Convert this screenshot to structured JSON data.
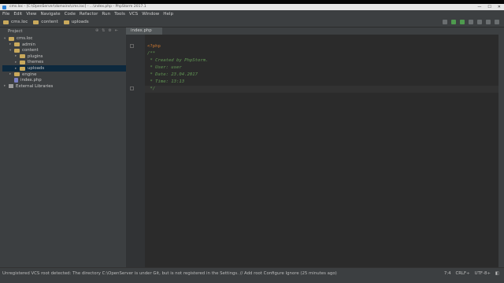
{
  "window": {
    "title": "cms.loc - [C:\\OpenServer\\domains\\cms.loc] - ...\\index.php - PhpStorm 2017.1",
    "controls": [
      "—",
      "☐",
      "✕"
    ]
  },
  "menu": [
    "File",
    "Edit",
    "View",
    "Navigate",
    "Code",
    "Refactor",
    "Run",
    "Tools",
    "VCS",
    "Window",
    "Help"
  ],
  "breadcrumbs": [
    "cms.loc",
    "content",
    "uploads"
  ],
  "project_panel": {
    "view_selector": "Project",
    "tree": [
      {
        "label": "cms.loc",
        "type": "folder",
        "level": 0,
        "expanded": true
      },
      {
        "label": "admin",
        "type": "folder",
        "level": 1,
        "expanded": false
      },
      {
        "label": "content",
        "type": "folder",
        "level": 1,
        "expanded": true
      },
      {
        "label": "plugins",
        "type": "folder",
        "level": 2,
        "expanded": false
      },
      {
        "label": "themes",
        "type": "folder",
        "level": 2,
        "expanded": false
      },
      {
        "label": "uploads",
        "type": "folder",
        "level": 2,
        "expanded": false,
        "selected": true
      },
      {
        "label": "engine",
        "type": "folder",
        "level": 1,
        "expanded": false
      },
      {
        "label": "index.php",
        "type": "php",
        "level": 1
      },
      {
        "label": "External Libraries",
        "type": "lib",
        "level": 0,
        "expanded": false
      }
    ]
  },
  "editor": {
    "tab_label": "index.php",
    "lines": [
      {
        "text": "<?php",
        "kind": "php"
      },
      {
        "text": "/**",
        "kind": "doc"
      },
      {
        "text": " * Created by PhpStorm.",
        "kind": "doc"
      },
      {
        "text": " * User: user",
        "kind": "doc"
      },
      {
        "text": " * Date: 23.04.2017",
        "kind": "doc"
      },
      {
        "text": " * Time: 13:13",
        "kind": "doc"
      },
      {
        "text": " */",
        "kind": "doc"
      }
    ]
  },
  "status": {
    "message": "Unregistered VCS root detected: The directory C:\\OpenServer is under Git, but is not registered in the Settings. // Add root  Configure  Ignore (25 minutes ago)",
    "position": "7:4",
    "line_sep": "CRLF÷",
    "encoding": "UTF-8÷"
  },
  "colors": {
    "accent": "#0d293e",
    "php_tag": "#cc7832",
    "doc_comment": "#629755",
    "editor_bg": "#2b2b2b"
  }
}
